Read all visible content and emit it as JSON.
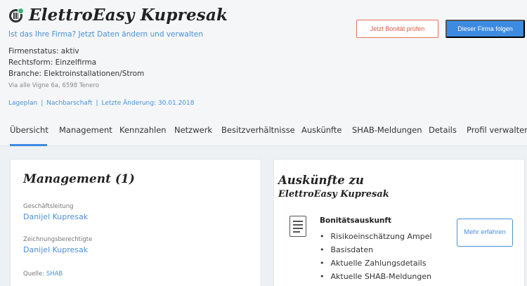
{
  "company": {
    "name": "ElettroEasy Kupresak",
    "claim_link": "Ist das Ihre Firma? Jetzt Daten ändern und verwalten",
    "status": "Firmenstatus: aktiv",
    "legal_form": "Rechtsform: Einzelfirma",
    "industry": "Branche: Elektroinstallationen/Strom",
    "address": "Via alle Vigne 6a, 6598 Tenero"
  },
  "links": {
    "map": "Lageplan",
    "neighborhood": "Nachbarschaft",
    "last_change": "Letzte Änderung: 30.01.2018",
    "separator": "|"
  },
  "buttons": {
    "check_credit": "Jetzt Bonität prüfen",
    "follow": "Dieser Firma folgen"
  },
  "tabs": [
    {
      "label": "Übersicht",
      "active": true
    },
    {
      "label": "Management"
    },
    {
      "label": "Kennzahlen"
    },
    {
      "label": "Netzwerk"
    },
    {
      "label": "Besitzverhältnisse"
    },
    {
      "label": "Auskünfte"
    },
    {
      "label": "SHAB-Meldungen"
    },
    {
      "label": "Details"
    },
    {
      "label": "Profil verwalten"
    }
  ],
  "management": {
    "title": "Management (1)",
    "roles": [
      {
        "role": "Geschäftsleitung",
        "person": "Danijel Kupresak"
      },
      {
        "role": "Zeichnungsberechtigte",
        "person": "Danijel Kupresak"
      }
    ],
    "source_label": "Quelle:",
    "source_value": "SHAB"
  },
  "auskuenfte": {
    "title": "Auskünfte zu",
    "subtitle": "ElettroEasy Kupresak",
    "report_title": "Bonitätsauskunft",
    "items": [
      "Risikoeinschätzung Ampel",
      "Basisdaten",
      "Aktuelle Zahlungsdetails",
      "Aktuelle SHAB-Meldungen"
    ],
    "more_button": "Mehr erfahren"
  },
  "colors": {
    "accent": "#3d8be0",
    "link": "#4a90d9",
    "warning_border": "#e8725a",
    "status_check": "#3bb273"
  }
}
